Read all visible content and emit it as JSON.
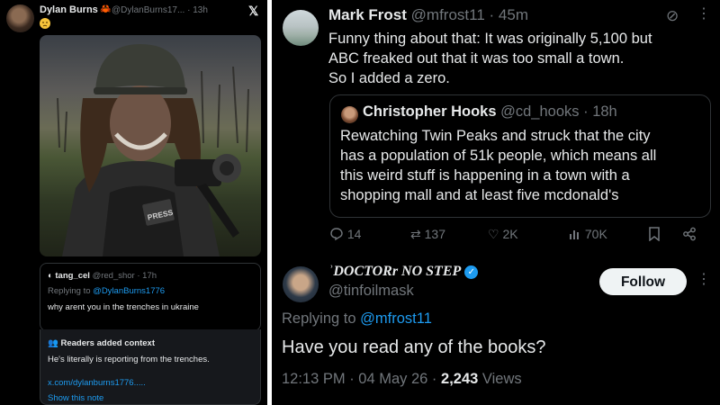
{
  "left_post": {
    "author_name": "Dylan Burns",
    "handle": "@DylanBurns17...",
    "time": "13h",
    "emoji_icon": "slightly-frowning-face-icon",
    "photo_badge": "PRESS",
    "reply": {
      "author": "tang_cel",
      "handle": "@red_shor",
      "time": "17h",
      "replying_label": "Replying to",
      "replying_handle": "@DylanBurns1776",
      "text": "why arent you in the trenches in ukraine"
    },
    "notes": {
      "title": "Readers added context",
      "text": "He's literally is reporting from the trenches.",
      "link": "x.com/dylanburns1776.....",
      "show_label": "Show this note"
    }
  },
  "right_post": {
    "author_name": "Mark Frost",
    "handle": "@mfrost11",
    "time": "45m",
    "text_lines": [
      "Funny thing about that: It was originally 5,100 but",
      "ABC freaked out that it was too small a town.",
      "So I added a zero."
    ],
    "quote": {
      "author_name": "Christopher Hooks",
      "handle": "@cd_hooks",
      "time": "18h",
      "text_lines": [
        "Rewatching Twin Peaks and struck that the city",
        "has a population of 51k people, which means all",
        "this weird stuff is happening in a town with a",
        "shopping mall and at least five mcdonald's"
      ]
    },
    "actions": {
      "replies": "14",
      "reposts": "137",
      "likes": "2K",
      "views": "70K"
    }
  },
  "reply_post": {
    "display_name": "ʾDOCTORr NO STEP",
    "handle": "@tinfoilmask",
    "follow_label": "Follow",
    "replying_label": "Replying to",
    "replying_handle": "@mfrost11",
    "text": "Have you read any of the books?",
    "meta_time": "12:13 PM · 04 May 26 ·",
    "meta_views_count": "2,243",
    "meta_views_label": "Views"
  },
  "colors": {
    "background": "#000000",
    "text": "#e7e9ea",
    "muted": "#71767b",
    "link": "#1d9bf0",
    "verified": "#1d9bf0",
    "border": "#2f3336"
  }
}
